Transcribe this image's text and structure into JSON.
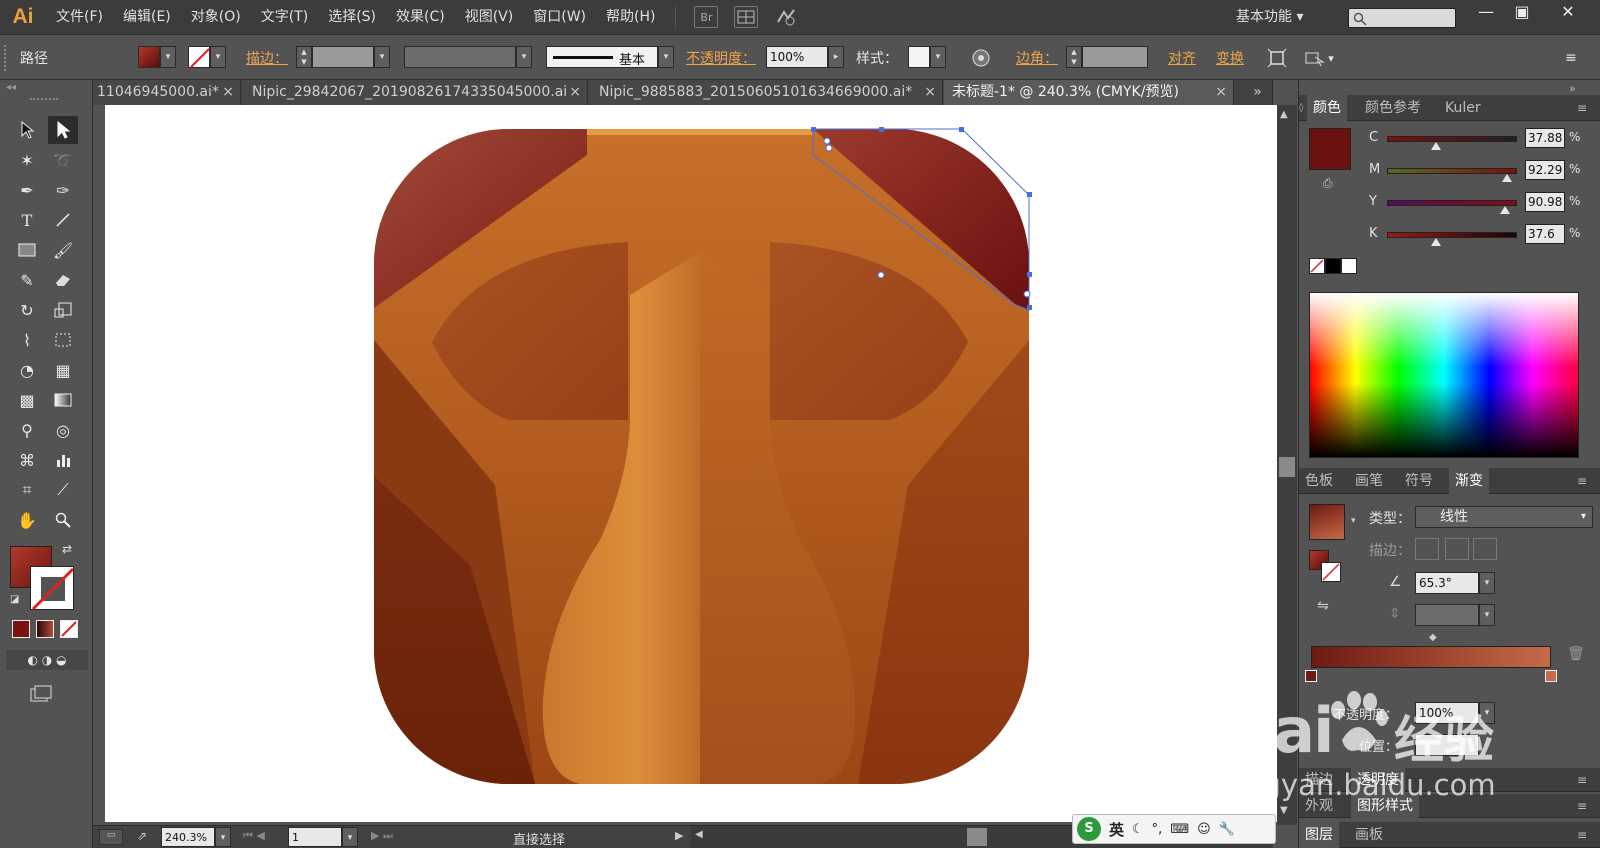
{
  "menubar": {
    "logo": "Ai",
    "items": [
      "文件(F)",
      "编辑(E)",
      "对象(O)",
      "文字(T)",
      "选择(S)",
      "效果(C)",
      "视图(V)",
      "窗口(W)",
      "帮助(H)"
    ],
    "bridge_label": "Br",
    "workspace": "基本功能",
    "window_buttons": [
      "—",
      "▣",
      "✕"
    ]
  },
  "controlbar": {
    "object_type": "路径",
    "stroke_label": "描边：",
    "stroke_style": "基本",
    "opacity_label": "不透明度：",
    "opacity_value": "100%",
    "style_label": "样式：",
    "corner_label": "边角：",
    "align_label": "对齐",
    "transform_label": "变换"
  },
  "tabs": [
    {
      "label": "11046945000.ai*",
      "active": false
    },
    {
      "label": "Nipic_29842067_20190826174335045000.ai",
      "active": false
    },
    {
      "label": "Nipic_9885883_20150605101634669000.ai*",
      "active": false
    },
    {
      "label": "未标题-1* @ 240.3% (CMYK/预览)",
      "active": true
    }
  ],
  "tab_close": "×",
  "tab_overflow": "»",
  "color_panel": {
    "tabs": [
      "颜色",
      "颜色参考",
      "Kuler"
    ],
    "fill_color": "#6b1110",
    "cmyk": [
      {
        "label": "C",
        "value": "37.88",
        "fraction": 0.379
      },
      {
        "label": "M",
        "value": "92.29",
        "fraction": 0.923
      },
      {
        "label": "Y",
        "value": "90.98",
        "fraction": 0.91
      },
      {
        "label": "K",
        "value": "37.6",
        "fraction": 0.376
      }
    ],
    "percent": "%"
  },
  "gradient_panel": {
    "tabs": [
      "色板",
      "画笔",
      "符号",
      "渐变"
    ],
    "type_label": "类型：",
    "type_value": "线性",
    "stroke_label": "描边：",
    "angle_value": "65.3°",
    "opacity_label": "不透明度：",
    "opacity_value": "100%",
    "location_label": "位置：",
    "start_color": "#6e1a12",
    "end_color": "#c66a48"
  },
  "bottom_panels": {
    "row1": [
      "描边",
      "透明度"
    ],
    "row2": [
      "外观",
      "图形样式"
    ],
    "row3": [
      "图层",
      "画板"
    ]
  },
  "statusbar": {
    "zoom": "240.3%",
    "page": "1",
    "tool_name": "直接选择"
  },
  "ime_bar": {
    "logo": "S",
    "lang": "英"
  },
  "watermark": {
    "brand": "Bai",
    "brand_cn": "经验",
    "url": "jingyan.baidu.com"
  },
  "colors": {
    "accent_orange": "#f0a44a",
    "ui_dark": "#3c3c3c",
    "ui_mid": "#535353"
  }
}
